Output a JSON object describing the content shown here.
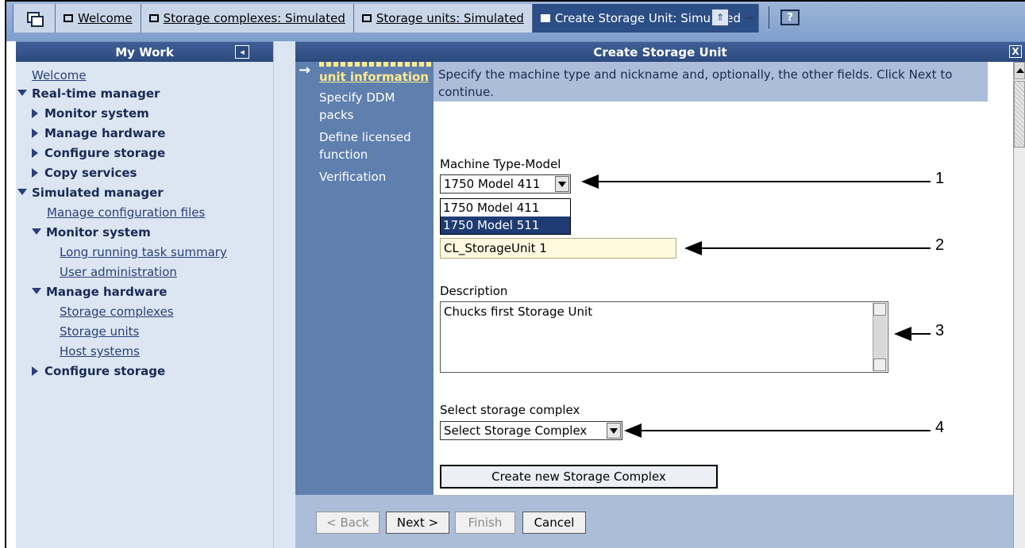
{
  "tabs": [
    {
      "label": "Welcome",
      "active": false
    },
    {
      "label": "Storage complexes: Simulated",
      "active": false
    },
    {
      "label": "Storage units: Simulated",
      "active": false
    },
    {
      "label": "Create Storage Unit: Simulated",
      "active": true
    }
  ],
  "toolbar": {
    "help_label": "?"
  },
  "left_pane": {
    "title": "My Work",
    "collapse_icon": "◂",
    "nav": {
      "welcome": "Welcome",
      "realtime_manager": "Real-time manager",
      "rt_monitor_system": "Monitor system",
      "rt_manage_hardware": "Manage hardware",
      "rt_configure_storage": "Configure storage",
      "rt_copy_services": "Copy services",
      "simulated_manager": "Simulated manager",
      "manage_config_files": "Manage configuration files",
      "sim_monitor_system": "Monitor system",
      "long_running_task": "Long running task summary",
      "user_admin": "User administration",
      "sim_manage_hardware": "Manage hardware",
      "storage_complexes": "Storage complexes",
      "storage_units": "Storage units",
      "host_systems": "Host systems",
      "sim_configure_storage": "Configure storage"
    }
  },
  "main": {
    "title": "Create Storage Unit",
    "close_label": "X",
    "steps": {
      "current": "unit information",
      "ddm": "Specify DDM packs",
      "licensed": "Define licensed function",
      "verification": "Verification"
    },
    "instructions": "Specify the machine type and nickname and, optionally, the other fields. Click Next to continue.",
    "machine_type_label": "Machine Type-Model",
    "machine_type_value": "1750 Model 411",
    "machine_type_options": [
      "1750 Model 411",
      "1750 Model 511"
    ],
    "nickname_value": "CL_StorageUnit 1",
    "description_label": "Description",
    "description_value": "Chucks first Storage Unit",
    "storage_complex_label": "Select storage complex",
    "storage_complex_value": "Select Storage Complex",
    "create_complex_label": "Create new Storage Complex"
  },
  "footer": {
    "back": "< Back",
    "next": "Next >",
    "finish": "Finish",
    "cancel": "Cancel"
  },
  "callouts": [
    "1",
    "2",
    "3",
    "4"
  ],
  "colors": {
    "header": "#2c4a7d",
    "nav_bg": "#dce6f3",
    "steps_bg": "#5f7fae",
    "instructions_bg": "#abbdd9",
    "current_step": "#ffeb8c"
  }
}
